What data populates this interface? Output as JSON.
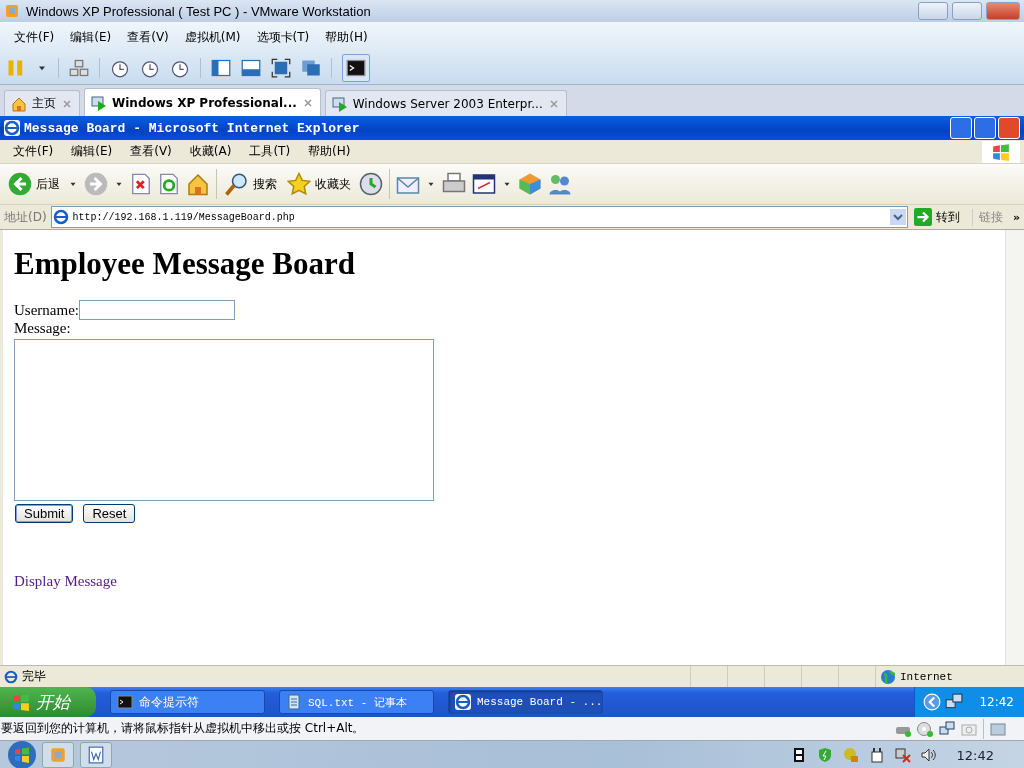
{
  "vmware": {
    "title": "Windows XP Professional ( Test PC )  - VMware Workstation",
    "menu": [
      "文件(F)",
      "编辑(E)",
      "查看(V)",
      "虚拟机(M)",
      "选项卡(T)",
      "帮助(H)"
    ],
    "tabs": [
      {
        "label": "主页",
        "kind": "home",
        "selected": false
      },
      {
        "label": "Windows XP Professional...",
        "kind": "vm",
        "selected": true
      },
      {
        "label": "Windows Server 2003 Enterpr...",
        "kind": "vm",
        "selected": false
      }
    ]
  },
  "ie": {
    "title": "Message Board - Microsoft Internet Explorer",
    "menu": [
      "文件(F)",
      "编辑(E)",
      "查看(V)",
      "收藏(A)",
      "工具(T)",
      "帮助(H)"
    ],
    "back": "后退",
    "search": "搜索",
    "favorites": "收藏夹",
    "address_label": "地址(D)",
    "address": "http://192.168.1.119/MessageBoard.php",
    "go": "转到",
    "links": "链接",
    "more": "»"
  },
  "page": {
    "heading": "Employee Message Board",
    "username_label": "Username:",
    "message_label": "Message:",
    "submit": "Submit",
    "reset": "Reset",
    "link": "Display Message"
  },
  "status": {
    "text": "完毕",
    "zone": "Internet"
  },
  "xp_taskbar": {
    "start": "开始",
    "tasks": [
      {
        "label": "命令提示符",
        "kind": "console",
        "selected": false
      },
      {
        "label": "SQL.txt - 记事本",
        "kind": "notepad",
        "selected": false
      },
      {
        "label": "Message Board - ...",
        "kind": "browser",
        "selected": true
      }
    ],
    "clock": "12:42"
  },
  "hint": "要返回到您的计算机，请将鼠标指针从虚拟机中移出或按 Ctrl+Alt。",
  "host_clock": "12:42"
}
